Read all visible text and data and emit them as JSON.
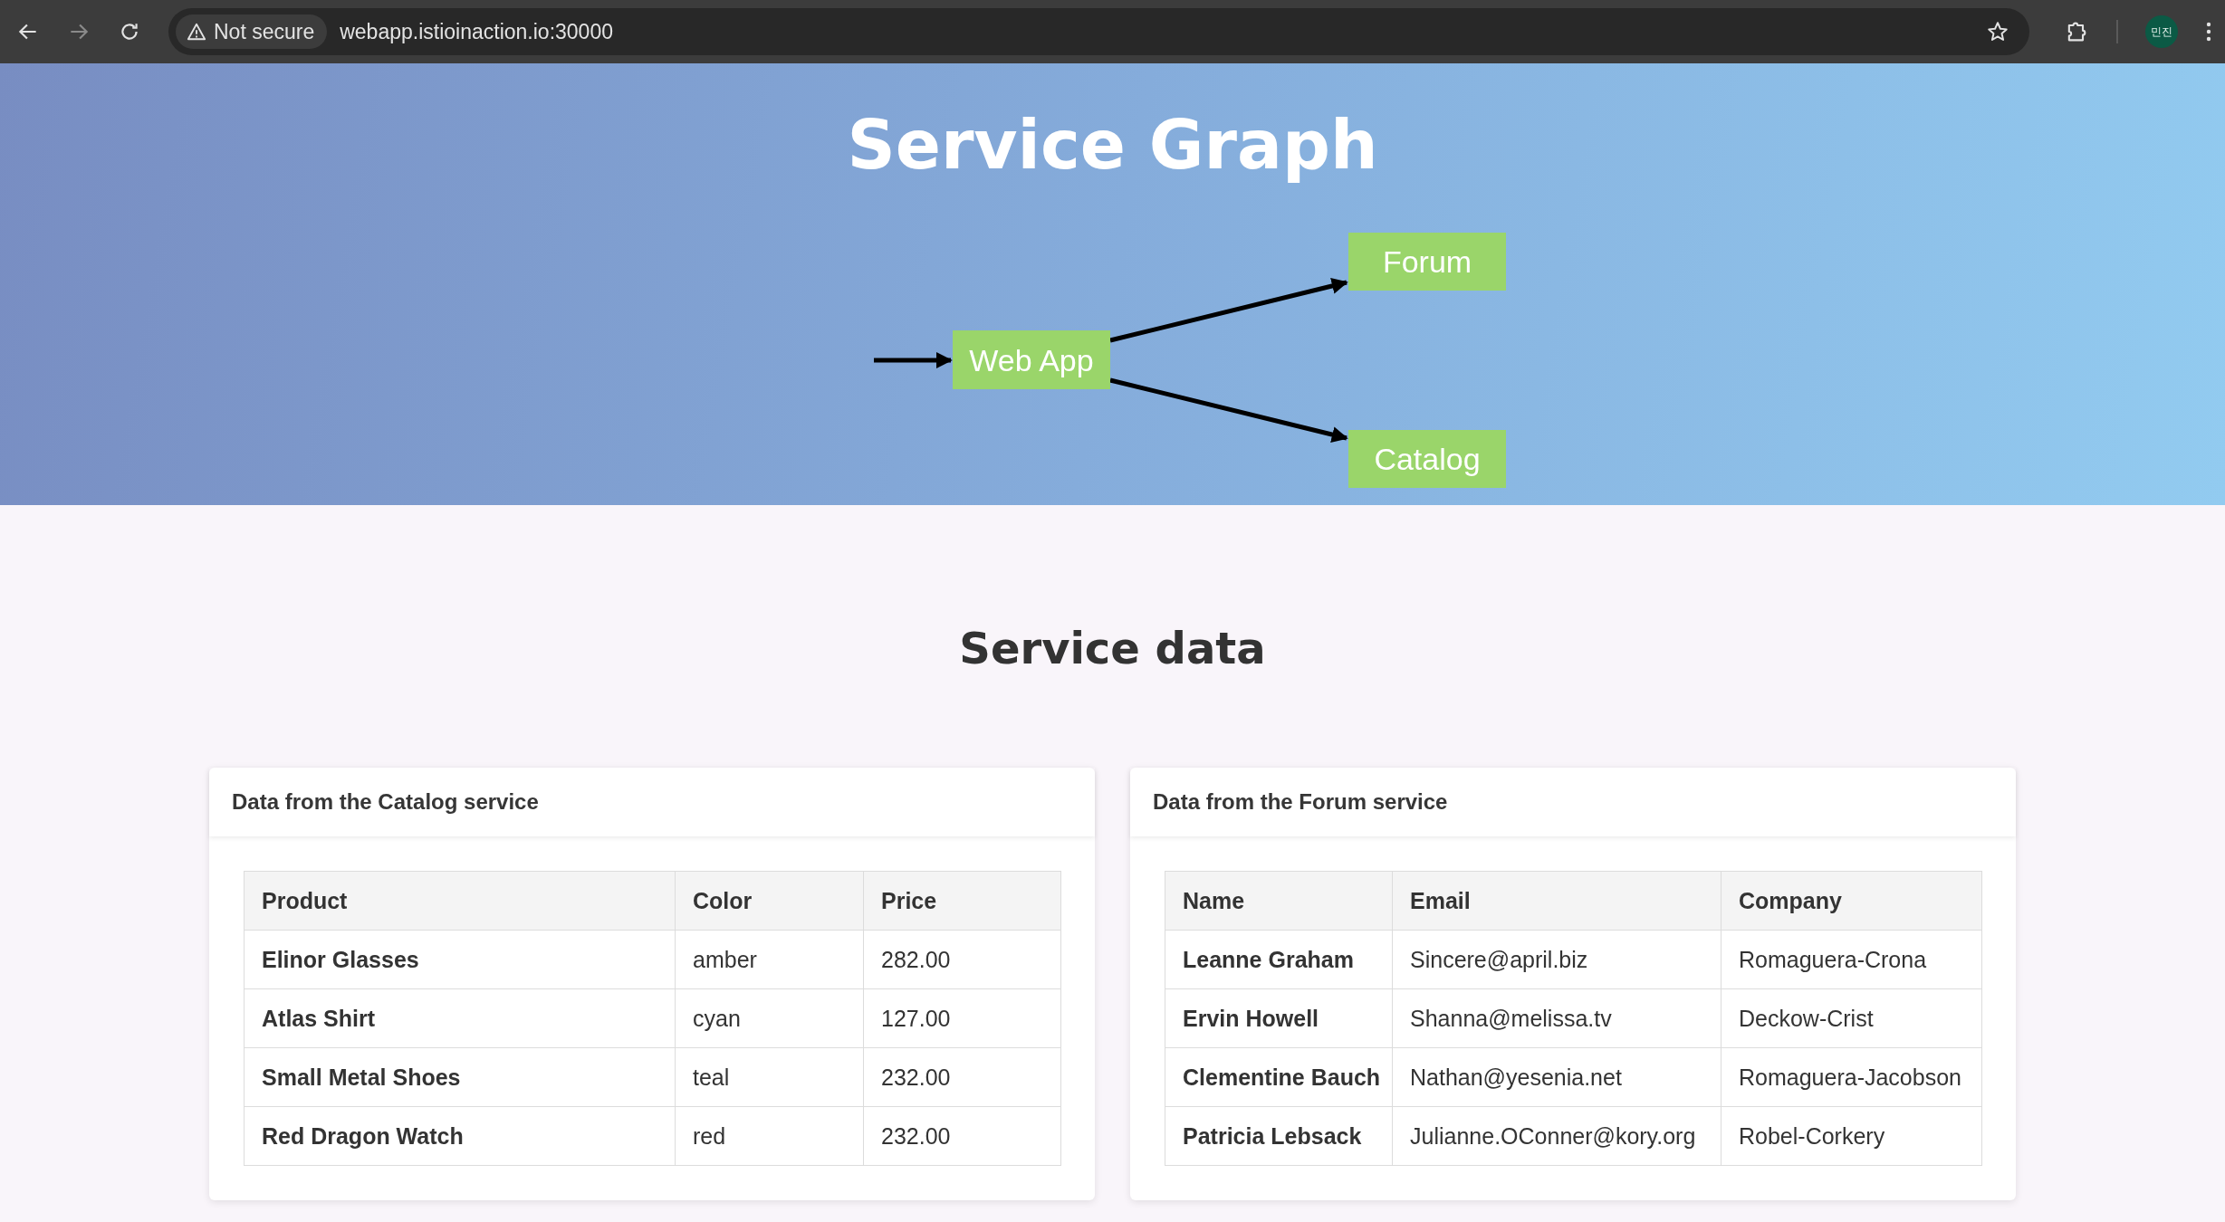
{
  "browser": {
    "security_label": "Not secure",
    "url": "webapp.istioinaction.io:30000",
    "profile": "민진"
  },
  "hero": {
    "title": "Service Graph",
    "nodes": [
      {
        "label": "Web App"
      },
      {
        "label": "Forum"
      },
      {
        "label": "Catalog"
      }
    ]
  },
  "section_title": "Service data",
  "panels": [
    {
      "title": "Data from the Catalog service",
      "columns": [
        "Product",
        "Color",
        "Price"
      ],
      "rows": [
        [
          "Elinor Glasses",
          "amber",
          "282.00"
        ],
        [
          "Atlas Shirt",
          "cyan",
          "127.00"
        ],
        [
          "Small Metal Shoes",
          "teal",
          "232.00"
        ],
        [
          "Red Dragon Watch",
          "red",
          "232.00"
        ]
      ]
    },
    {
      "title": "Data from the Forum service",
      "columns": [
        "Name",
        "Email",
        "Company"
      ],
      "rows": [
        [
          "Leanne Graham",
          "Sincere@april.biz",
          "Romaguera-Crona"
        ],
        [
          "Ervin Howell",
          "Shanna@melissa.tv",
          "Deckow-Crist"
        ],
        [
          "Clementine Bauch",
          "Nathan@yesenia.net",
          "Romaguera-Jacobson"
        ],
        [
          "Patricia Lebsack",
          "Julianne.OConner@kory.org",
          "Robel-Corkery"
        ]
      ]
    }
  ]
}
